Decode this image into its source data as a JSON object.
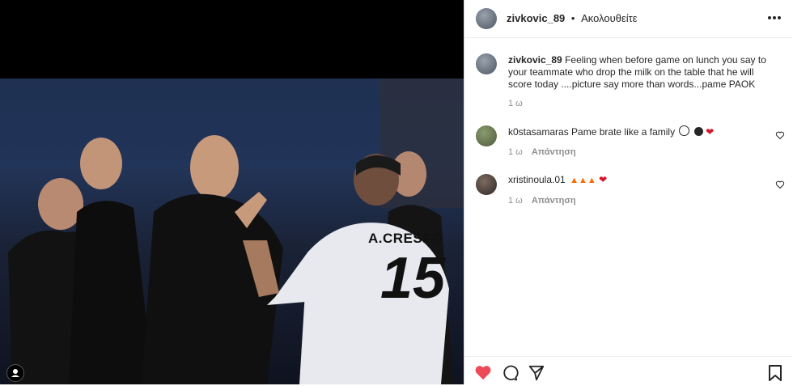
{
  "post": {
    "author": "zivkovic_89",
    "separator": "•",
    "follow_label": "Ακολουθείτε",
    "caption": "Feeling when before game on lunch you say to your teammate who drop the milk on the table that he will score today ....picture say more than words...pame PAOK",
    "caption_time": "1 ω",
    "jersey_name": "A.CRESPO",
    "jersey_number": "15"
  },
  "comments": [
    {
      "user": "k0stasamaras",
      "text": "Pame brate like a family",
      "time": "1 ω",
      "reply": "Απάντηση"
    },
    {
      "user": "xristinoula.01",
      "text": "",
      "time": "1 ω",
      "reply": "Απάντηση"
    }
  ],
  "colors": {
    "like_red": "#ed4956",
    "text": "#262626",
    "muted": "#8e8e8e"
  }
}
